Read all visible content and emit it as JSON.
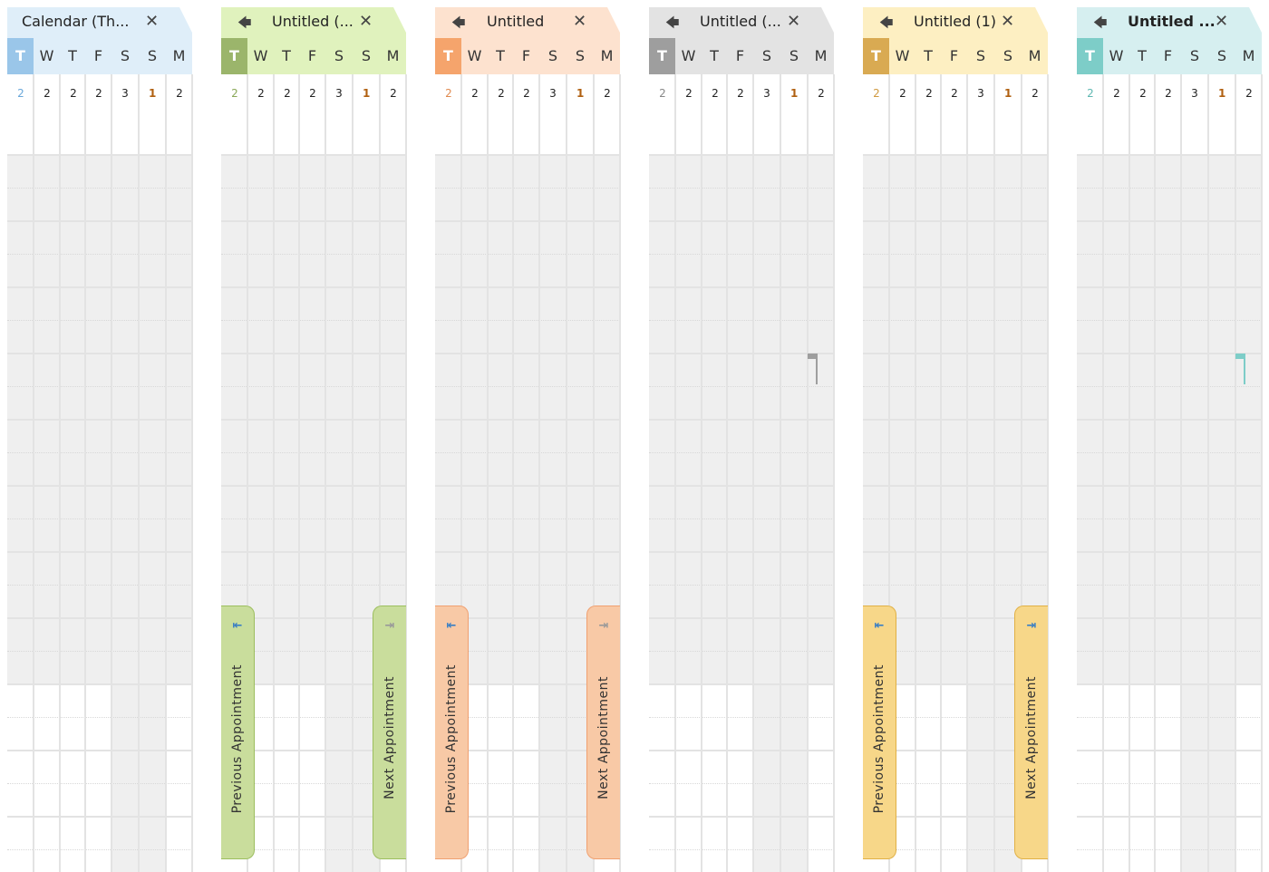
{
  "days": [
    "T",
    "W",
    "T",
    "F",
    "S",
    "S",
    "M"
  ],
  "dates": [
    "2",
    "2",
    "2",
    "2",
    "3",
    "1",
    "2"
  ],
  "nav": {
    "previous_label": "Previous Appointment",
    "next_label": "Next Appointment"
  },
  "panels": [
    {
      "title": "Calendar (Th...",
      "has_back": false,
      "tab_color": "#dfeef9",
      "sel_color": "#9ac6e9",
      "date_color": "#6aa8da",
      "buttons": null,
      "flag": null
    },
    {
      "title": "Untitled (...",
      "has_back": true,
      "tab_color": "#e0f2bd",
      "sel_color": "#9bb56b",
      "date_color": "#8aa858",
      "buttons": {
        "fill": "#c9dd9c",
        "border": "#9cbe5e",
        "prev_icon_color": "#3a7fc4",
        "next_icon_color": "#999999"
      },
      "flag": null
    },
    {
      "title": "Untitled",
      "has_back": true,
      "tab_color": "#fde2cf",
      "sel_color": "#f5a46c",
      "date_color": "#e08a50",
      "buttons": {
        "fill": "#f8c9a6",
        "border": "#f0a070",
        "prev_icon_color": "#3a7fc4",
        "next_icon_color": "#999999"
      },
      "flag": null
    },
    {
      "title": "Untitled (...",
      "has_back": true,
      "tab_color": "#e3e3e3",
      "sel_color": "#9e9e9e",
      "date_color": "#888888",
      "buttons": null,
      "flag": "#9e9e9e"
    },
    {
      "title": "Untitled (1)",
      "has_back": true,
      "tab_color": "#fdefc2",
      "sel_color": "#d9aa52",
      "date_color": "#d09a40",
      "buttons": {
        "fill": "#f7d789",
        "border": "#e0b045",
        "prev_icon_color": "#3a7fc4",
        "next_icon_color": "#3a7fc4"
      },
      "flag": null
    },
    {
      "title": "Untitled ...",
      "has_back": true,
      "tab_color": "#d6eff0",
      "sel_color": "#7dcdc8",
      "date_color": "#5fb8b2",
      "buttons": null,
      "flag": "#7dcdc8",
      "bold_title": true
    }
  ],
  "icons": {
    "back": "back-arrow-icon",
    "close": "close-icon",
    "prev": "previous-appointment-icon",
    "next": "next-appointment-icon",
    "flag": "flag-icon"
  }
}
